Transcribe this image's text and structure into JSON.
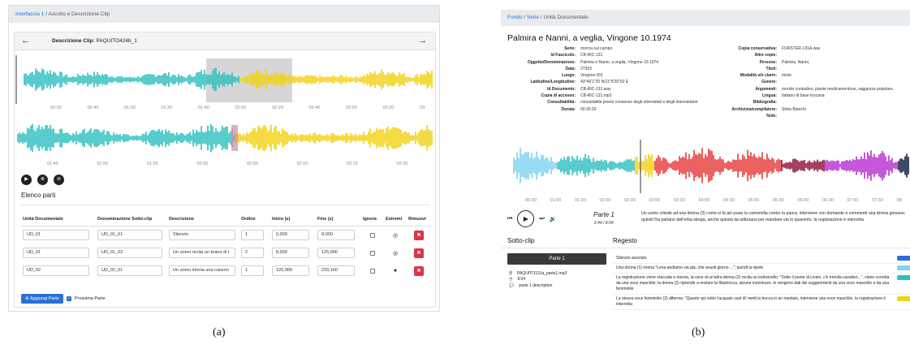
{
  "panel_a": {
    "breadcrumb": {
      "root": "Interfaccia 1",
      "sep": "/",
      "current": "Ascolto e Descrizione Clip"
    },
    "header": {
      "prev_icon": "arrow-left-icon",
      "next_icon": "arrow-right-icon",
      "title_label": "Descrizione Clip:",
      "clip_name": "PAQUITO424b_1"
    },
    "colors": {
      "teal": "#2ebfbf",
      "yellow": "#f2d215",
      "selection": "#c8c8c8"
    },
    "overview_ticks": [
      "00:30",
      "00:40",
      "01:00",
      "01:20",
      "01:40",
      "02:00",
      "02:20",
      "02:40",
      "03:00",
      "03:20",
      "03:"
    ],
    "zoom_ticks": [
      "01:45",
      "01:50",
      "01:55",
      "02:00",
      "02:05",
      "02:10",
      "02:15",
      "02:20",
      "02:25"
    ],
    "controls": {
      "play": "▶",
      "zoom_in": "⊕",
      "zoom_out": "⊖"
    },
    "section_title": "Elenco parti",
    "table": {
      "headers": [
        "Unità Documentale",
        "Denominazione Sotto-clip",
        "Descrizione",
        "Ordine",
        "Inizio (s)",
        "Fine (s)",
        "Ignora",
        "Estremi",
        "Rimuovi"
      ],
      "rows": [
        {
          "ud": "UD_01",
          "name": "UD_01_01",
          "desc": "Silenzio",
          "order": "1",
          "start": "0,000",
          "end": "8,000"
        },
        {
          "ud": "UD_01",
          "name": "UD_01_02",
          "desc": "Un uomo recita un brano di l",
          "order": "2",
          "start": "8,000",
          "end": "125,000"
        },
        {
          "ud": "UD_02",
          "name": "UD_02_01",
          "desc": "Un uomo intona una canzon",
          "order": "1",
          "start": "125,000",
          "end": "220,160"
        }
      ]
    },
    "add_button": "Aggiungi Parte",
    "next_part_label": "Prossima Parte"
  },
  "panel_b": {
    "breadcrumb": {
      "root": "Fondo",
      "mid": "Serie",
      "sep": "/",
      "current": "Unità Documentale"
    },
    "title": "Palmira e Nanni, a veglia, Vingone 10.1974",
    "meta_left": [
      {
        "k": "Serie:",
        "v": "ricerca sul campo"
      },
      {
        "k": "Id Fascicolo:",
        "v": "CB-RIC-131"
      },
      {
        "k": "Oggetto/Denominazione:",
        "v": "Palmira e Nanni, a veglia, Vingone 10.1974"
      },
      {
        "k": "Data:",
        "v": "27303"
      },
      {
        "k": "Luogo:",
        "v": "Vingone (FI)"
      },
      {
        "k": "Latitudine/Longitudine:",
        "v": "43°46'1\"20 N/11°9'20\"52 E"
      },
      {
        "k": "Id Documento:",
        "v": "CB-RIC-131.wav"
      },
      {
        "k": "Copia di accesso:",
        "v": "CB-RIC-131.mp3"
      },
      {
        "k": "Consultabilità:",
        "v": "consultabile previo consenso degli intervistati e degli intervistatori"
      },
      {
        "k": "Durata:",
        "v": "00:30:29"
      }
    ],
    "meta_right": [
      {
        "k": "Copia conservativa:",
        "v": "FORSTER-131A.wav"
      },
      {
        "k": "Altre copie:",
        "v": ""
      },
      {
        "k": "Persone:",
        "v": "Palmira, Nanni,"
      },
      {
        "k": "Titoli:",
        "v": ""
      },
      {
        "k": "Modalità v/o clarin:",
        "v": "misto"
      },
      {
        "k": "Genere:",
        "v": ""
      },
      {
        "k": "Argomenti:",
        "v": "mondo contadino, piante medicamentose, saggezza popolare,"
      },
      {
        "k": "Lingua:",
        "v": "Italiano di base toscana"
      },
      {
        "k": "Bibliografia:",
        "v": ""
      },
      {
        "k": "Archivista/compilatore:",
        "v": "Silvia Bianchi"
      },
      {
        "k": "Note:",
        "v": ""
      }
    ],
    "segment_colors": [
      "#7fd3ee",
      "#2ebfbf",
      "#f2d215",
      "#e83a3a",
      "#8a1238",
      "#b52dd1",
      "#111a3a"
    ],
    "ticks": [
      "00:30",
      "01:00",
      "01:30",
      "02:00",
      "02:30",
      "03:00",
      "03:30",
      "04:00",
      "04:30",
      "05:00",
      "05:30",
      "06:00",
      "06:30",
      "07:00",
      "07:30",
      "08:"
    ],
    "player": {
      "prev": "⏮",
      "play": "▶",
      "next": "⏭",
      "volume": "🔊"
    },
    "part_title": "Parte 1",
    "part_time": "2:44 / 8:04",
    "part_desc": "Un uomo chiede ad una donna (3) come si fa ad usare la camomilla contro la paura; interviene con domande e commenti una donna giovane; quindi l'ha parlano dell'erba strega, anche questa da utilizzarsi per mandare via lo spavento. la registrazione è interrotta",
    "subclip_header": "Sotto-clip",
    "regesto_header": "Regesto",
    "part_button": "Parte 1",
    "files": [
      {
        "icon": "file-icon",
        "text": "PAQUITO131a_parte1.mp3"
      },
      {
        "icon": "clock-icon",
        "text": "8:04"
      },
      {
        "icon": "comment-icon",
        "text": "parte 1 description"
      }
    ],
    "regesto": [
      {
        "text": "Silenzio assoluto",
        "color": "#2a6fd6"
      },
      {
        "text": "Una donna (1) intona \"Lena andiamo via già, che avanti giorno ...\"; quindi la ripete",
        "color": "#7fd3ee"
      },
      {
        "text": "La registrazione viene staccata e riavvia, la voce di un'altra donna (2) recita un indovinello: \"Sotto il ponte di Livieri, c'è tremila cavalieri...\", viene corretta da una voce maschile; la donna (2) riprende a recitare la filastrocca, alcune incertezze, le vengono dati dei suggerimenti da una voce maschile e da una femminile",
        "color": "#2ebfbf"
      },
      {
        "text": "La stessa voce femminile (2) afferma: \"Questo qui sotto l'acquaio vuol di' metti la bocca in un mestaio, interviene una voce maschile, la registrazione è interrotta",
        "color": "#f2d215"
      }
    ]
  },
  "captions": {
    "a": "(a)",
    "b": "(b)"
  }
}
